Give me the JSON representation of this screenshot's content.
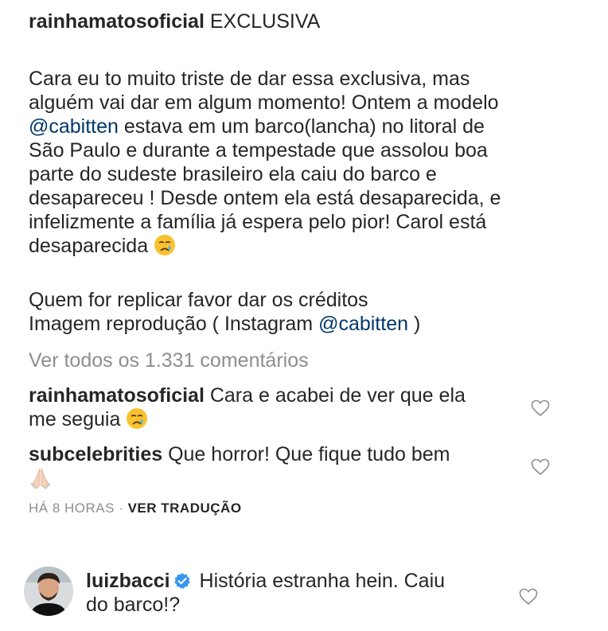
{
  "post": {
    "author": "rainhamatosoficial",
    "title_text": "EXCLUSIVA",
    "caption_lines": [
      "Cara eu to muito triste de dar essa exclusiva, mas",
      "alguém vai dar em algum momento! Ontem a modelo"
    ],
    "mention_1": "@cabitten",
    "caption_after_mention": " estava em um barco(lancha) no litoral de",
    "caption_lines_2": [
      "São Paulo e durante a tempestade que assolou boa",
      "parte do sudeste brasileiro ela caiu do barco e",
      "desapareceu ! Desde ontem ela está desaparecida, e",
      "infelizmente a família já espera pelo pior! Carol está"
    ],
    "caption_last_line": "desaparecida",
    "credits_line": "Quem for replicar favor dar os créditos",
    "image_credit_prefix": "Imagem reprodução ( Instagram ",
    "mention_2": "@cabitten",
    "image_credit_suffix": " )"
  },
  "view_all_comments": "Ver todos os 1.331 comentários",
  "comments": [
    {
      "username": "rainhamatosoficial",
      "line1": " Cara e acabei de ver que ela",
      "line2": "me seguia"
    },
    {
      "username": "subcelebrities",
      "line1": " Que horror! Que fique tudo bem"
    }
  ],
  "meta": {
    "time_ago": "HÁ 8 HORAS",
    "separator": " · ",
    "translate": "VER TRADUÇÃO"
  },
  "reply": {
    "username": "luizbacci",
    "line1": " História estranha hein. Caiu",
    "line2": "do barco!?"
  },
  "colors": {
    "text": "#262626",
    "muted": "#8e8e8e",
    "mention": "#00376b",
    "verified": "#3897f0"
  },
  "icons": [
    "crying-face-icon",
    "heart-icon",
    "verified-badge-icon",
    "folded-hands-icon"
  ]
}
